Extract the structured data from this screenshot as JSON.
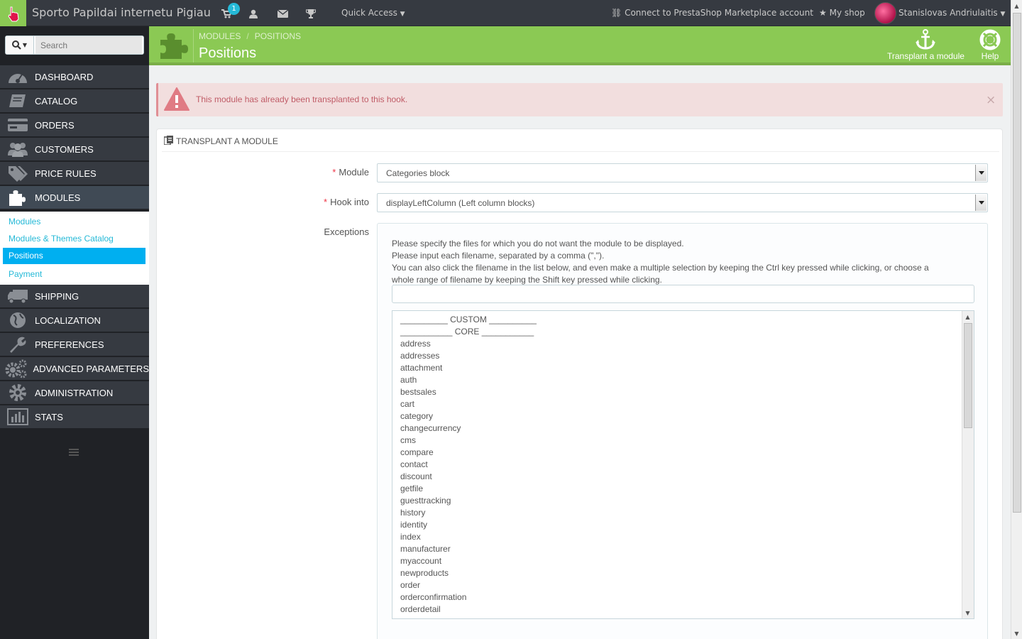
{
  "topbar": {
    "shop_name": "Sporto Papildai internetu Pigiau",
    "cart_count": "1",
    "quick_access": "Quick Access",
    "connect_link": "Connect to PrestaShop Marketplace account",
    "my_shop": "My shop",
    "user_name": "Stanislovas Andriulaitis"
  },
  "sidebar": {
    "search_placeholder": "Search",
    "items": [
      {
        "label": "DASHBOARD",
        "icon": "dashboard-icon"
      },
      {
        "label": "CATALOG",
        "icon": "book-icon"
      },
      {
        "label": "ORDERS",
        "icon": "credit-card-icon"
      },
      {
        "label": "CUSTOMERS",
        "icon": "users-icon"
      },
      {
        "label": "PRICE RULES",
        "icon": "tags-icon"
      },
      {
        "label": "MODULES",
        "icon": "puzzle-icon",
        "active": true
      },
      {
        "label": "SHIPPING",
        "icon": "truck-icon"
      },
      {
        "label": "LOCALIZATION",
        "icon": "globe-icon"
      },
      {
        "label": "PREFERENCES",
        "icon": "wrench-icon"
      },
      {
        "label": "ADVANCED PARAMETERS",
        "icon": "cogs-icon"
      },
      {
        "label": "ADMINISTRATION",
        "icon": "cog-icon"
      },
      {
        "label": "STATS",
        "icon": "bar-chart-icon"
      }
    ],
    "submenu": [
      {
        "label": "Modules"
      },
      {
        "label": "Modules & Themes Catalog"
      },
      {
        "label": "Positions",
        "active": true
      },
      {
        "label": "Payment"
      }
    ]
  },
  "header": {
    "breadcrumb": [
      "MODULES",
      "POSITIONS"
    ],
    "title": "Positions",
    "toolbar": {
      "transplant": "Transplant a module",
      "help": "Help"
    }
  },
  "alert": {
    "text": "This module has already been transplanted to this hook.",
    "close": "×"
  },
  "panel": {
    "title": "TRANSPLANT A MODULE",
    "module_label": "Module",
    "module_value": "Categories block",
    "hook_label": "Hook into",
    "hook_value": "displayLeftColumn (Left column blocks)",
    "exceptions_label": "Exceptions",
    "help_lines": [
      "Please specify the files for which you do not want the module to be displayed.",
      "Please input each filename, separated by a comma (\",\").",
      "You can also click the filename in the list below, and even make a multiple selection by keeping the Ctrl key pressed while clicking, or choose a",
      "whole range of filename by keeping the Shift key pressed while clicking."
    ],
    "files": [
      "__________ CUSTOM __________",
      "___________ CORE ___________",
      "address",
      "addresses",
      "attachment",
      "auth",
      "bestsales",
      "cart",
      "category",
      "changecurrency",
      "cms",
      "compare",
      "contact",
      "discount",
      "getfile",
      "guesttracking",
      "history",
      "identity",
      "index",
      "manufacturer",
      "myaccount",
      "newproducts",
      "order",
      "orderconfirmation",
      "orderdetail"
    ]
  },
  "colors": {
    "accent_green": "#8bc954",
    "sidebar_bg": "#363a41",
    "link_blue": "#25b9d7",
    "alert_text": "#c05c67"
  }
}
